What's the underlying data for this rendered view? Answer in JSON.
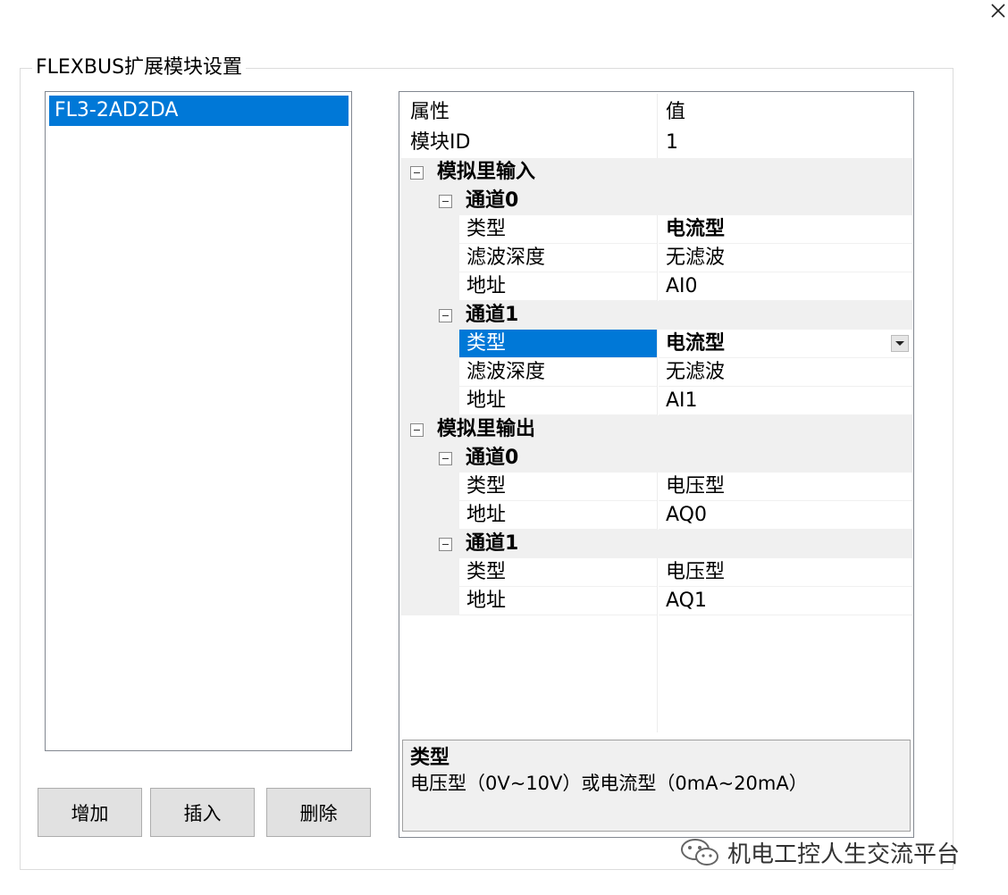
{
  "group_title": "FLEXBUS扩展模块设置",
  "modules": [
    {
      "label": "FL3-2AD2DA",
      "selected": true
    }
  ],
  "buttons": {
    "add": "增加",
    "insert": "插入",
    "delete": "删除"
  },
  "grid": {
    "header": {
      "prop": "属性",
      "value": "值"
    },
    "module_id": {
      "prop": "模块ID",
      "value": "1"
    },
    "ai": {
      "label": "模拟里输入",
      "ch0": {
        "label": "通道0",
        "type": {
          "prop": "类型",
          "value": "电流型"
        },
        "filter": {
          "prop": "滤波深度",
          "value": "无滤波"
        },
        "addr": {
          "prop": "地址",
          "value": "AI0"
        }
      },
      "ch1": {
        "label": "通道1",
        "type": {
          "prop": "类型",
          "value": "电流型"
        },
        "filter": {
          "prop": "滤波深度",
          "value": "无滤波"
        },
        "addr": {
          "prop": "地址",
          "value": "AI1"
        }
      }
    },
    "ao": {
      "label": "模拟里输出",
      "ch0": {
        "label": "通道0",
        "type": {
          "prop": "类型",
          "value": "电压型"
        },
        "addr": {
          "prop": "地址",
          "value": "AQ0"
        }
      },
      "ch1": {
        "label": "通道1",
        "type": {
          "prop": "类型",
          "value": "电压型"
        },
        "addr": {
          "prop": "地址",
          "value": "AQ1"
        }
      }
    }
  },
  "help": {
    "title": "类型",
    "description": "电压型（0V~10V）或电流型（0mA~20mA）"
  },
  "watermark": "机电工控人生交流平台",
  "colors": {
    "selection": "#0078d7",
    "category_bg": "#f0f0f0",
    "button_bg": "#e1e1e1"
  },
  "icons": [
    "close-icon",
    "collapse-icon",
    "dropdown-icon",
    "wechat-icon"
  ]
}
